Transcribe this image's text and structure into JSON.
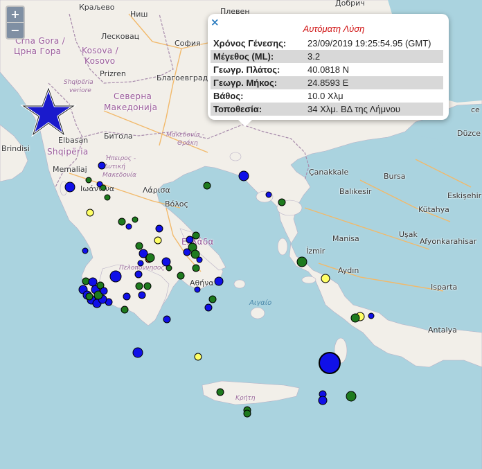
{
  "zoom": {
    "in_label": "+",
    "out_label": "−"
  },
  "popup": {
    "close_label": "×",
    "title": "Αυτόματη Λύση",
    "rows": [
      {
        "key": "Χρόνος Γένεσης:",
        "value": "23/09/2019 19:25:54.95 (GMT)"
      },
      {
        "key": "Μέγεθος (ML):",
        "value": "3.2"
      },
      {
        "key": "Γεωγρ. Πλάτος:",
        "value": "40.0818 N"
      },
      {
        "key": "Γεωγρ. Μήκος:",
        "value": "24.8593 E"
      },
      {
        "key": "Βάθος:",
        "value": "10.0 Χλμ"
      },
      {
        "key": "Τοποθεσία:",
        "value": "34 Χλμ. ΒΔ της Λήμνου"
      }
    ]
  },
  "labels": {
    "kraljevo": "Краљево",
    "nis": "Ниш",
    "pleven": "Плевен",
    "dobrich": "Добрич",
    "crna_gora": "Crna Gora /",
    "crna_gora2": "Црна Гора",
    "leskovac": "Лесковац",
    "kosova": "Kosova /",
    "kosovo": "Kosovo",
    "sofia": "София",
    "prizren": "Prizren",
    "blagoevgrad": "Благоевград",
    "shqiperia_v": "Shqipëria",
    "veriore": "veriore",
    "severna": "Северна",
    "makedonija": "Македонија",
    "bitola": "Битола",
    "makedonia_thraki": "Μακεδονία -",
    "thraki": "Θράκη",
    "elbasan": "Elbasan",
    "shqiperia": "Shqipëria",
    "brindisi": "Brindisi",
    "memaliaj": "Memaliaj",
    "ipeiros": "Ήπειρος -",
    "dytiki_mak": "Δυτική",
    "makedonia": "Μακεδονία",
    "ioannina": "Ιωάννινα",
    "larisa": "Λάρισα",
    "volos": "Βόλος",
    "canakkale": "Çanakkale",
    "bursa": "Bursa",
    "balikesir": "Balıkesir",
    "eskisehir": "Eskişehir",
    "kutahya": "Kütahya",
    "usak": "Uşak",
    "afyonkarahisar": "Afyonkarahisar",
    "ellada": "Ελλάδα",
    "izmir": "İzmir",
    "manisa": "Manisa",
    "aydin": "Aydın",
    "isparta": "Isparta",
    "peloponnisos": "Πελοπόννησος",
    "athina": "Αθήνα",
    "aigaio": "Αιγαίο",
    "antalya": "Antalya",
    "kriti": "Κρήτη",
    "duzce": "Düzce",
    "edge_ce": "ce"
  },
  "colors": {
    "sea": "#aad3df",
    "land": "#f2efe9",
    "event_blue": "#1010e8",
    "event_green": "#1e7a1e",
    "event_yellow": "#ffff66",
    "event_orange": "#e86a2a",
    "star": "#1a1acc",
    "popup_title": "#d01414"
  },
  "marker_icons": [
    "star-icon"
  ]
}
